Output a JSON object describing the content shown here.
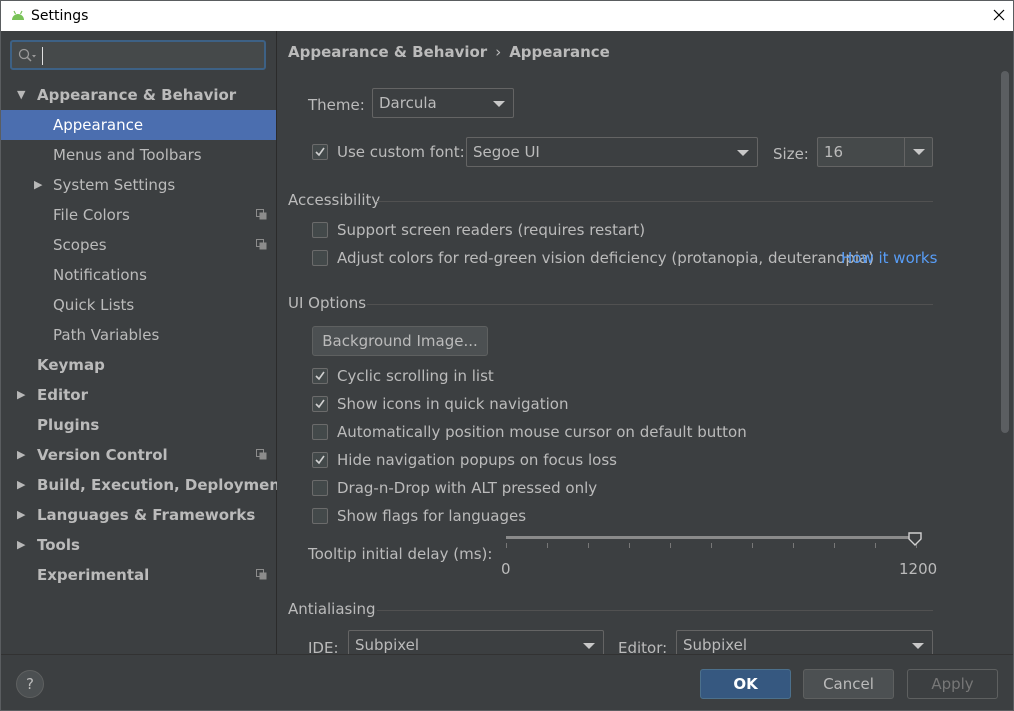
{
  "window": {
    "title": "Settings"
  },
  "search": {
    "placeholder": ""
  },
  "sidebar": {
    "items": [
      {
        "label": "Appearance & Behavior"
      },
      {
        "label": "Appearance"
      },
      {
        "label": "Menus and Toolbars"
      },
      {
        "label": "System Settings"
      },
      {
        "label": "File Colors"
      },
      {
        "label": "Scopes"
      },
      {
        "label": "Notifications"
      },
      {
        "label": "Quick Lists"
      },
      {
        "label": "Path Variables"
      },
      {
        "label": "Keymap"
      },
      {
        "label": "Editor"
      },
      {
        "label": "Plugins"
      },
      {
        "label": "Version Control"
      },
      {
        "label": "Build, Execution, Deployment"
      },
      {
        "label": "Languages & Frameworks"
      },
      {
        "label": "Tools"
      },
      {
        "label": "Experimental"
      }
    ]
  },
  "breadcrumb": {
    "parent": "Appearance & Behavior",
    "separator": "›",
    "current": "Appearance"
  },
  "theme": {
    "label": "Theme:",
    "value": "Darcula"
  },
  "font": {
    "checkbox_label": "Use custom font:",
    "checked": true,
    "value": "Segoe UI",
    "size_label": "Size:",
    "size_value": "16"
  },
  "accessibility": {
    "title": "Accessibility",
    "screen_readers": {
      "label": "Support screen readers (requires restart)",
      "checked": false
    },
    "color_deficiency": {
      "label": "Adjust colors for red-green vision deficiency (protanopia, deuteranopia)",
      "checked": false
    },
    "link": "How it works"
  },
  "ui_options": {
    "title": "UI Options",
    "background_button": "Background Image...",
    "checks": [
      {
        "label": "Cyclic scrolling in list",
        "checked": true
      },
      {
        "label": "Show icons in quick navigation",
        "checked": true
      },
      {
        "label": "Automatically position mouse cursor on default button",
        "checked": false
      },
      {
        "label": "Hide navigation popups on focus loss",
        "checked": true
      },
      {
        "label": "Drag-n-Drop with ALT pressed only",
        "checked": false
      },
      {
        "label": "Show flags for languages",
        "checked": false
      }
    ],
    "tooltip": {
      "label": "Tooltip initial delay (ms):",
      "min": "0",
      "max": "1200",
      "value": 1200
    }
  },
  "antialiasing": {
    "title": "Antialiasing",
    "ide_label": "IDE:",
    "ide_value": "Subpixel",
    "editor_label": "Editor:",
    "editor_value": "Subpixel"
  },
  "footer": {
    "help": "?",
    "ok": "OK",
    "cancel": "Cancel",
    "apply": "Apply"
  },
  "colors": {
    "accent": "#4b6eaf",
    "link": "#589df6",
    "background": "#3c3f41",
    "ok_button": "#365880"
  }
}
